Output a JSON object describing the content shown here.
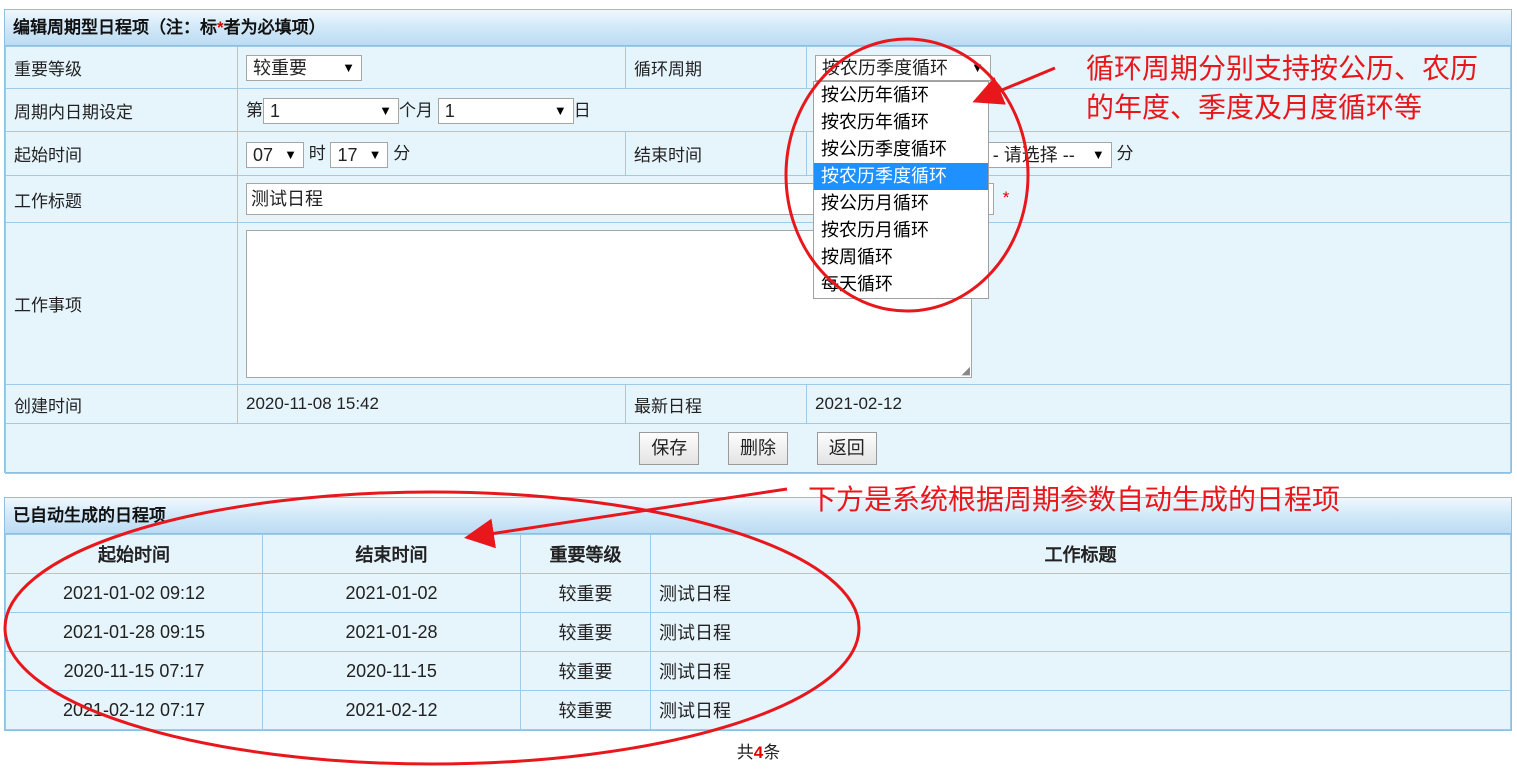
{
  "form": {
    "title_prefix": "编辑周期型日程项（注：标",
    "title_star": "*",
    "title_suffix": "者为必填项）",
    "importance_label": "重要等级",
    "importance_value": "较重要",
    "cycle_label": "循环周期",
    "cycle_value": "按农历季度循环",
    "date_setting_label": "周期内日期设定",
    "date_prefix": "第",
    "date_num1": "1",
    "date_mid": "个月",
    "date_num2": "1",
    "date_suffix": "日",
    "start_label": "起始时间",
    "start_hour": "07",
    "hour_unit": "时",
    "start_min": "17",
    "min_unit": "分",
    "end_label": "结束时间",
    "end_min_placeholder": "- 请选择 --",
    "end_min_unit": "分",
    "work_title_label": "工作标题",
    "work_title_value": "测试日程",
    "work_title_star": "*",
    "work_item_label": "工作事项",
    "created_label": "创建时间",
    "created_value": "2020-11-08 15:42",
    "latest_label": "最新日程",
    "latest_value": "2021-02-12",
    "save": "保存",
    "delete": "删除",
    "back": "返回"
  },
  "dropdown": {
    "options": [
      "按公历年循环",
      "按农历年循环",
      "按公历季度循环",
      "按农历季度循环",
      "按公历月循环",
      "按农历月循环",
      "按周循环",
      "每天循环"
    ],
    "selected_index": 3
  },
  "list": {
    "title": "已自动生成的日程项",
    "headers": [
      "起始时间",
      "结束时间",
      "重要等级",
      "工作标题"
    ],
    "rows": [
      [
        "2021-01-02 09:12",
        "2021-01-02",
        "较重要",
        "测试日程"
      ],
      [
        "2021-01-28 09:15",
        "2021-01-28",
        "较重要",
        "测试日程"
      ],
      [
        "2020-11-15 07:17",
        "2020-11-15",
        "较重要",
        "测试日程"
      ],
      [
        "2021-02-12 07:17",
        "2021-02-12",
        "较重要",
        "测试日程"
      ]
    ]
  },
  "footer": {
    "prefix": "共",
    "count": "4",
    "suffix": "条"
  },
  "annotations": {
    "top_line1": "循环周期分别支持按公历、农历",
    "top_line2": "的年度、季度及月度循环等",
    "bottom": "下方是系统根据周期参数自动生成的日程项"
  },
  "colors": {
    "annotation": "#e8171c",
    "panel_bg": "#e6f4fc",
    "selected": "#1e90ff"
  }
}
